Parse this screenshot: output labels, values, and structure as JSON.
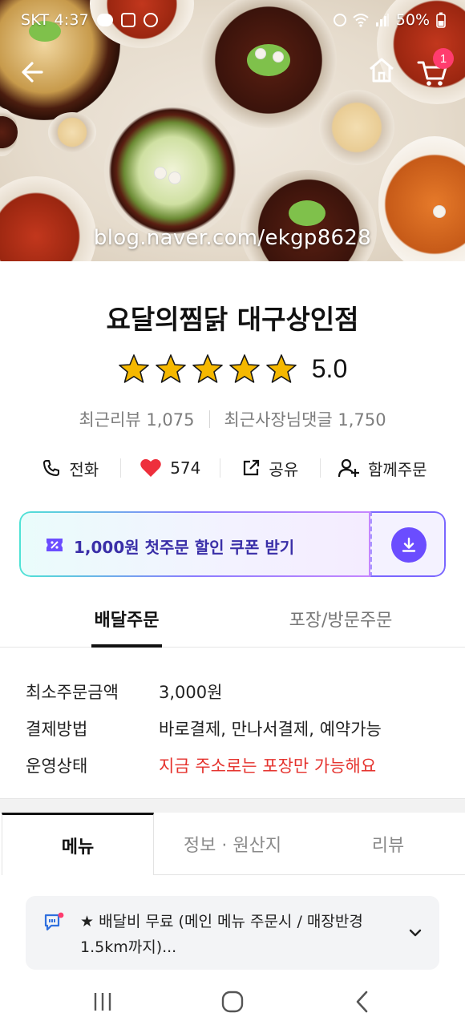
{
  "status_bar": {
    "carrier_time": "SKT 4:37",
    "battery": "50%"
  },
  "hero": {
    "watermark": "blog.naver.com/ekgp8628",
    "cart_count": "1"
  },
  "store": {
    "name": "요달의찜닭 대구상인점",
    "rating": "5.0",
    "stars": 5,
    "recent_reviews": "최근리뷰 1,075",
    "owner_replies": "최근사장님댓글 1,750"
  },
  "actions": {
    "call": "전화",
    "likes": "574",
    "share": "공유",
    "group_order": "함께주문"
  },
  "coupon": {
    "label": "1,000원 첫주문 할인 쿠폰 받기"
  },
  "order_tabs": {
    "delivery": "배달주문",
    "pickup": "포장/방문주문"
  },
  "info": {
    "min_order_label": "최소주문금액",
    "min_order_value": "3,000원",
    "payment_label": "결제방법",
    "payment_value": "바로결제, 만나서결제, 예약가능",
    "status_label": "운영상태",
    "status_value": "지금 주소로는 포장만 가능해요"
  },
  "menu_tabs": {
    "menu": "메뉴",
    "info": "정보 · 원산지",
    "review": "리뷰"
  },
  "notice": {
    "text": "★ 배달비 무료 (메인 메뉴 주문시 / 매장반경 1.5km까지)..."
  },
  "colors": {
    "accent_purple": "#6b4dff",
    "warning_red": "#e5322d",
    "badge_pink": "#ff3c6e",
    "star_yellow": "#f5b800"
  }
}
